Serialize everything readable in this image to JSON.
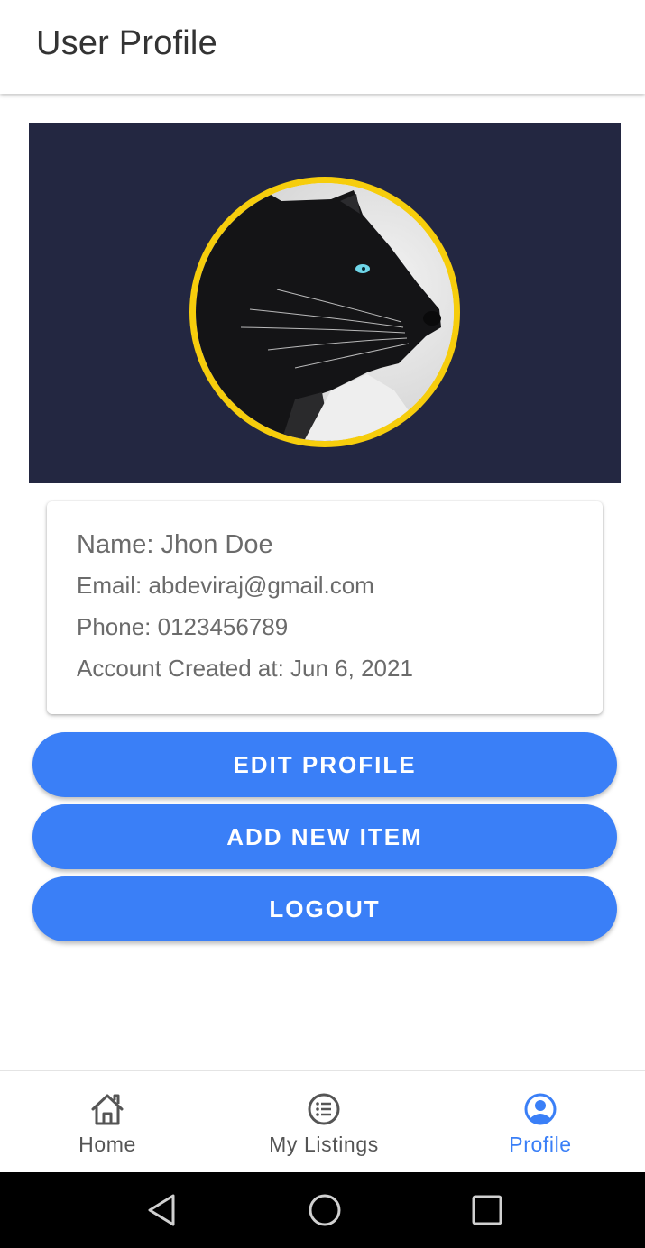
{
  "appbar": {
    "title": "User Profile"
  },
  "profile": {
    "name_line": "Name: Jhon Doe",
    "email_line": "Email: abdeviraj@gmail.com",
    "phone_line": "Phone: 0123456789",
    "created_line": "Account Created at: Jun 6, 2021"
  },
  "buttons": {
    "edit": "EDIT PROFILE",
    "add": "ADD NEW ITEM",
    "logout": "LOGOUT"
  },
  "bottom_nav": {
    "items": [
      {
        "label": "Home",
        "icon": "home-icon",
        "active": false
      },
      {
        "label": "My Listings",
        "icon": "list-icon",
        "active": false
      },
      {
        "label": "Profile",
        "icon": "account-circle-icon",
        "active": true
      }
    ]
  },
  "system_nav": {
    "icons": [
      "back-triangle-icon",
      "home-circle-icon",
      "recents-square-icon"
    ]
  },
  "colors": {
    "accent": "#3a7ff7",
    "banner": "#232741",
    "avatar_ring": "#f6cd0c"
  }
}
